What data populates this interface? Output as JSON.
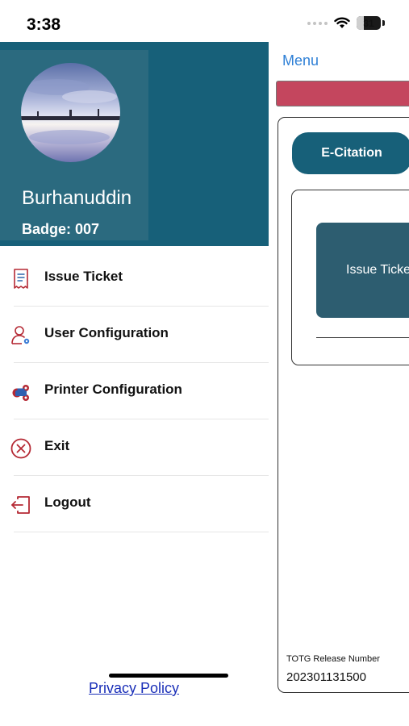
{
  "status_bar": {
    "time": "3:38",
    "battery": "31",
    "battery_level": 0.31
  },
  "drawer": {
    "user_name": "Burhanuddin",
    "badge": "Badge: 007",
    "menu": [
      {
        "label": "Issue Ticket",
        "icon": "receipt-icon"
      },
      {
        "label": "User Configuration",
        "icon": "user-settings-icon"
      },
      {
        "label": "Printer Configuration",
        "icon": "printer-gears-icon"
      },
      {
        "label": "Exit",
        "icon": "close-circle-icon"
      },
      {
        "label": "Logout",
        "icon": "logout-icon"
      }
    ],
    "privacy_policy": "Privacy Policy"
  },
  "main": {
    "menu_link": "Menu",
    "ecitation_button": "E-Citation",
    "issue_tile": "Issue Ticket",
    "release_label": "TOTG Release Number",
    "release_number": "202301131500"
  },
  "colors": {
    "header": "#176079",
    "profile_card": "#2b6a7f",
    "accent_pink": "#c4465e",
    "tile": "#2d5d70",
    "link_blue": "#2f80d6",
    "icon_red": "#b52a35"
  }
}
